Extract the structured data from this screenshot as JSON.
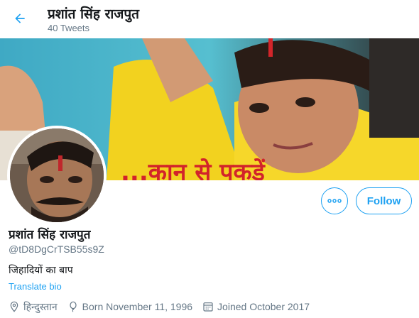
{
  "header": {
    "title": "प्रशांत सिंह राजपुत",
    "tweet_count": "40 Tweets",
    "back_icon": "arrow-left-icon"
  },
  "banner": {
    "overlay_text": "...कान से पकड़ें"
  },
  "profile": {
    "display_name": "प्रशांत सिंह राजपुत",
    "handle": "@tD8DgCrTSB55s9Z",
    "bio": "जिहादियों का बाप",
    "translate_label": "Translate bio",
    "location": "हिन्दुस्तान",
    "birth": "Born November 11, 1996",
    "joined": "Joined October 2017"
  },
  "actions": {
    "more_icon": "more-dots-icon",
    "follow_label": "Follow"
  },
  "colors": {
    "accent": "#1da1f2",
    "muted": "#657786",
    "text": "#14171a"
  }
}
